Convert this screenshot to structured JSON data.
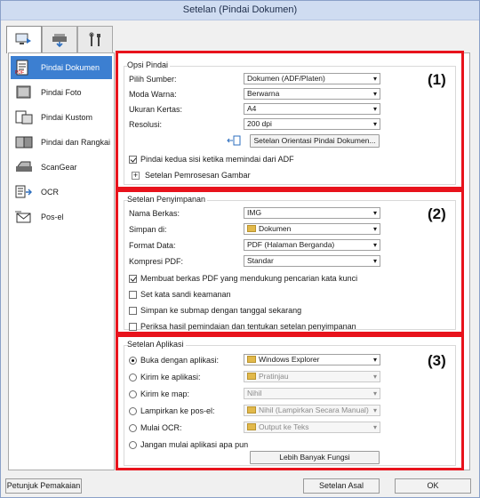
{
  "window": {
    "title": "Setelan (Pindai Dokumen)"
  },
  "tabs": [
    {
      "icon": "scan-from-computer-icon"
    },
    {
      "icon": "scan-from-operation-panel-icon"
    },
    {
      "icon": "tools-icon"
    }
  ],
  "sidebar": {
    "items": [
      {
        "label": "Pindai Dokumen",
        "icon": "document-scan-icon",
        "active": true
      },
      {
        "label": "Pindai Foto",
        "icon": "photo-scan-icon"
      },
      {
        "label": "Pindai Kustom",
        "icon": "custom-scan-icon"
      },
      {
        "label": "Pindai dan Rangkai",
        "icon": "scan-and-stitch-icon"
      },
      {
        "label": "ScanGear",
        "icon": "scangear-icon"
      },
      {
        "label": "OCR",
        "icon": "ocr-icon"
      },
      {
        "label": "Pos-el",
        "icon": "email-icon"
      }
    ]
  },
  "markers": {
    "m1": "(1)",
    "m2": "(2)",
    "m3": "(3)"
  },
  "scan_options": {
    "title": "Opsi Pindai",
    "source_label": "Pilih Sumber:",
    "source_value": "Dokumen (ADF/Platen)",
    "color_label": "Moda Warna:",
    "color_value": "Berwarna",
    "paper_label": "Ukuran Kertas:",
    "paper_value": "A4",
    "resolution_label": "Resolusi:",
    "resolution_value": "200 dpi",
    "orientation_button": "Setelan Orientasi Pindai Dokumen...",
    "duplex_label": "Pindai kedua sisi ketika memindai dari ADF",
    "image_processing_label": "Setelan Pemrosesan Gambar"
  },
  "save_settings": {
    "title": "Setelan Penyimpanan",
    "file_name_label": "Nama Berkas:",
    "file_name_value": "IMG",
    "save_in_label": "Simpan di:",
    "save_in_value": "Dokumen",
    "format_label": "Format Data:",
    "format_value": "PDF (Halaman Berganda)",
    "compression_label": "Kompresi PDF:",
    "compression_value": "Standar",
    "checks": [
      {
        "label": "Membuat berkas PDF yang mendukung pencarian kata kunci",
        "checked": true
      },
      {
        "label": "Set kata sandi keamanan",
        "checked": false
      },
      {
        "label": "Simpan ke submap dengan tanggal sekarang",
        "checked": false
      },
      {
        "label": "Periksa hasil pemindaian dan tentukan setelan penyimpanan",
        "checked": false
      }
    ]
  },
  "app_settings": {
    "title": "Setelan Aplikasi",
    "rows": [
      {
        "label": "Buka dengan aplikasi:",
        "value": "Windows Explorer",
        "selected": true,
        "icon": true,
        "disabled": false
      },
      {
        "label": "Kirim ke aplikasi:",
        "value": "Pratinjau",
        "selected": false,
        "icon": true,
        "disabled": true
      },
      {
        "label": "Kirim ke map:",
        "value": "Nihil",
        "selected": false,
        "icon": false,
        "disabled": true
      },
      {
        "label": "Lampirkan ke pos-el:",
        "value": "Nihil (Lampirkan Secara Manual)",
        "selected": false,
        "icon": true,
        "disabled": true
      },
      {
        "label": "Mulai OCR:",
        "value": "Output ke Teks",
        "selected": false,
        "icon": true,
        "disabled": true
      },
      {
        "label": "Jangan mulai aplikasi apa pun",
        "selected": false
      }
    ],
    "more_functions_button": "Lebih Banyak Fungsi"
  },
  "footer": {
    "manual_button": "Petunjuk Pemakaian",
    "defaults_button": "Setelan Asal",
    "ok_button": "OK"
  }
}
